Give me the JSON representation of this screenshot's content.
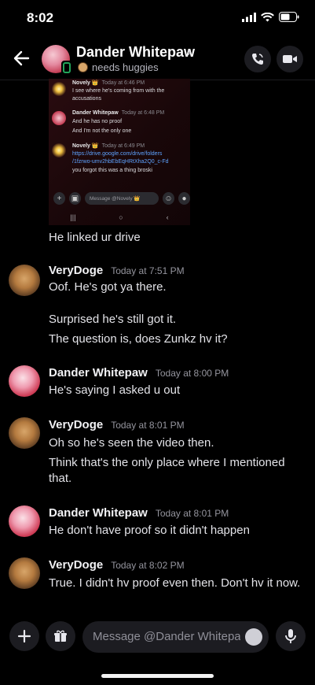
{
  "status_bar": {
    "time": "8:02"
  },
  "header": {
    "name": "Dander Whitepaw",
    "status_text": "needs huggies"
  },
  "embed": {
    "messages": [
      {
        "name": "Novely",
        "crown": "👑",
        "time": "Today at 6:46 PM",
        "lines": [
          "I see where he's coming from with the",
          "accusations"
        ]
      },
      {
        "name": "Dander Whitepaw",
        "time": "Today at 6:48 PM",
        "lines": [
          "And he has no proof",
          "And I'm not the only one"
        ]
      },
      {
        "name": "Novely",
        "crown": "👑",
        "time": "Today at 6:49 PM",
        "link_lines": [
          "https://drive.google.com/drive/folders",
          "/1fzrwo-umv2hbEbEqHRtXha2Q0_c-Fd"
        ],
        "lines": [
          "you forgot this was a thing broski"
        ]
      }
    ],
    "input_placeholder": "Message @Novely 👑"
  },
  "chat": [
    {
      "type": "continuation",
      "text": "He linked ur drive"
    },
    {
      "type": "group",
      "author": "VeryDoge",
      "avatar": "doge",
      "time": "Today at 7:51 PM",
      "lines": [
        "Oof. He's got ya there.",
        "",
        "Surprised he's still got it.",
        "The question is, does Zunkz hv it?"
      ]
    },
    {
      "type": "group",
      "author": "Dander Whitepaw",
      "avatar": "dander",
      "time": "Today at 8:00 PM",
      "lines": [
        "He's saying I asked u out"
      ]
    },
    {
      "type": "group",
      "author": "VeryDoge",
      "avatar": "doge",
      "time": "Today at 8:01 PM",
      "lines": [
        "Oh so he's seen the video then.",
        "Think that's the only place where I mentioned",
        "that."
      ]
    },
    {
      "type": "group",
      "author": "Dander Whitepaw",
      "avatar": "dander",
      "time": "Today at 8:01 PM",
      "lines": [
        "He don't have proof so it didn't happen"
      ]
    },
    {
      "type": "group",
      "author": "VeryDoge",
      "avatar": "doge",
      "time": "Today at 8:02 PM",
      "lines": [
        "True. I didn't hv proof even then. Don't hv it now."
      ]
    }
  ],
  "input": {
    "placeholder": "Message @Dander Whitepaw"
  },
  "colors": {
    "background": "#000000",
    "online": "#23a55a",
    "link": "#5ea3ff"
  }
}
